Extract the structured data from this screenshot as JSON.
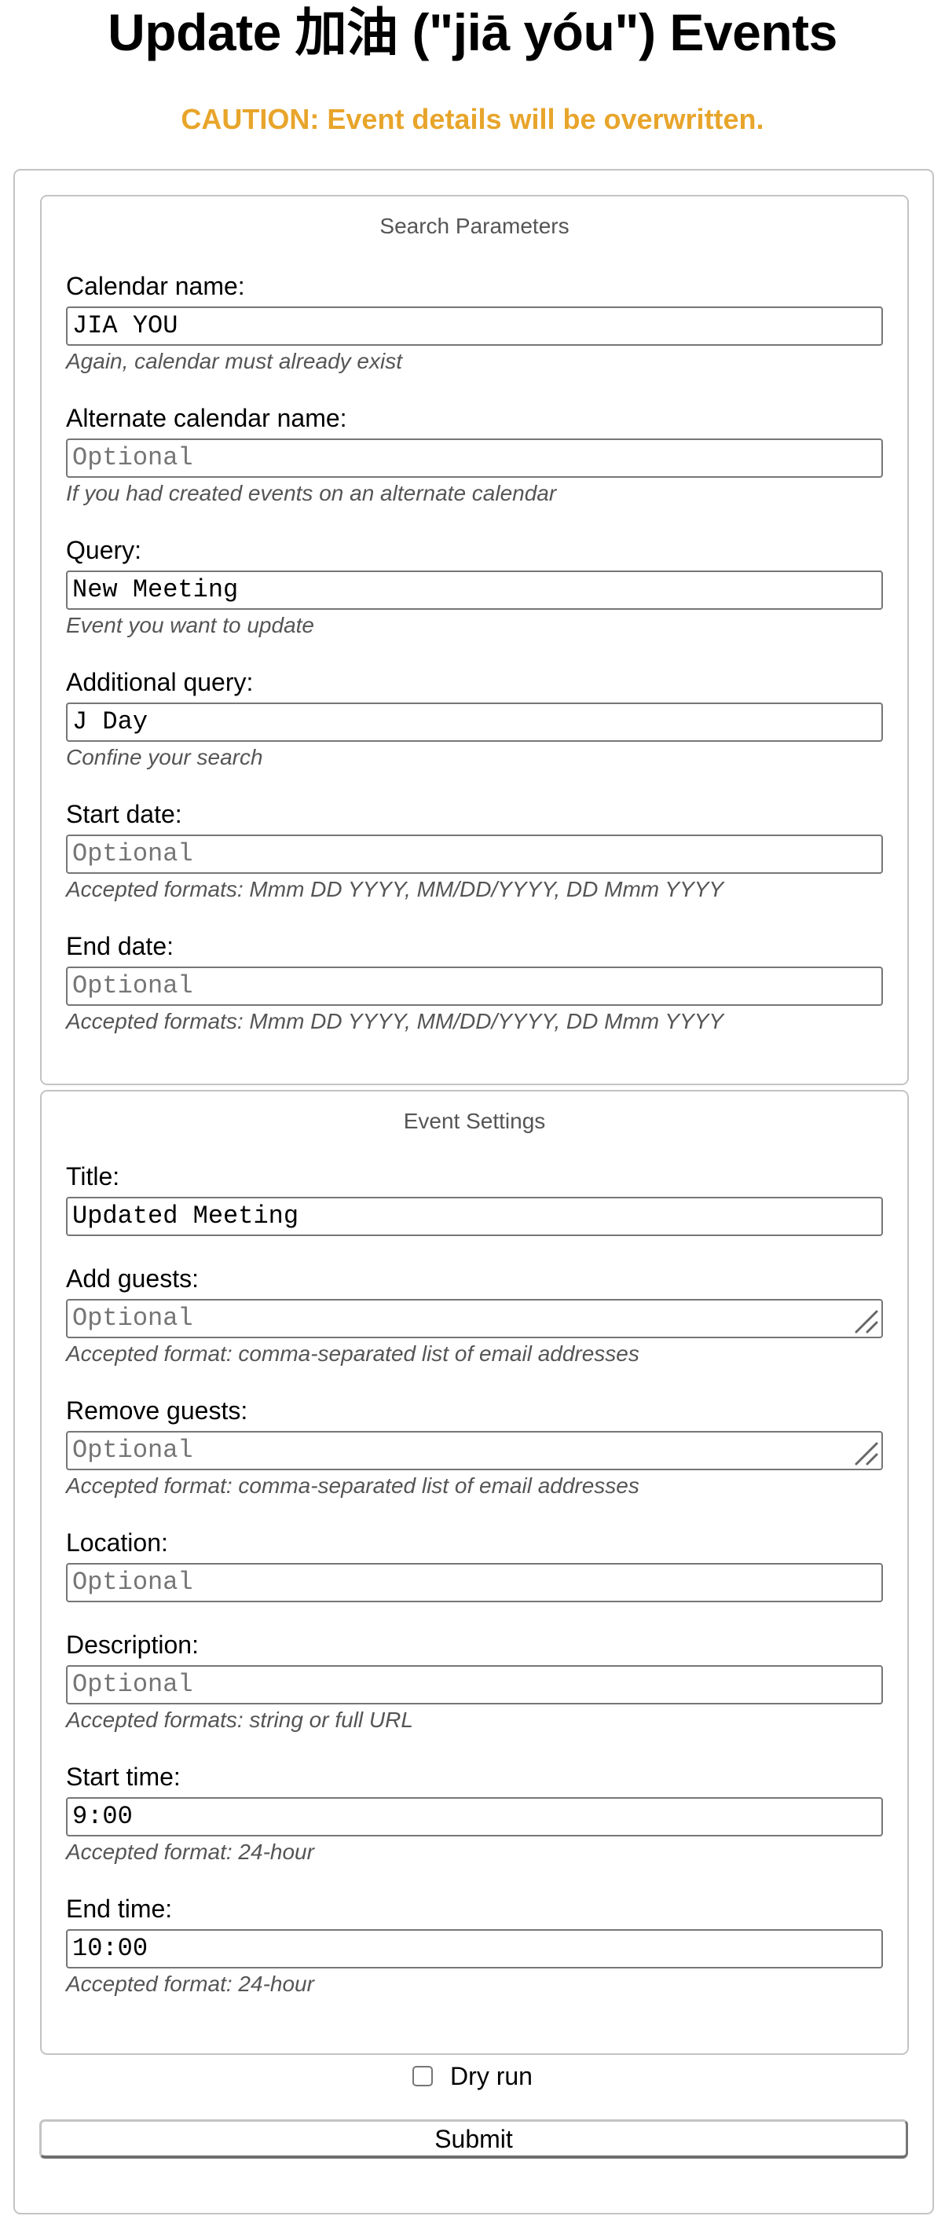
{
  "header": {
    "title": "Update 加油 (\"jiā yóu\") Events",
    "caution": "CAUTION: Event details will be overwritten.",
    "caution_color": "#E8A52B"
  },
  "search": {
    "legend": "Search Parameters",
    "fields": [
      {
        "label": "Calendar name:",
        "value": "JIA YOU",
        "placeholder": "",
        "hint": "Again, calendar must already exist"
      },
      {
        "label": "Alternate calendar name:",
        "value": "",
        "placeholder": "Optional",
        "hint": "If you had created events on an alternate calendar"
      },
      {
        "label": "Query:",
        "value": "New Meeting",
        "placeholder": "",
        "hint": "Event you want to update"
      },
      {
        "label": "Additional query:",
        "value": "J Day",
        "placeholder": "",
        "hint": "Confine your search"
      },
      {
        "label": "Start date:",
        "value": "",
        "placeholder": "Optional",
        "hint": "Accepted formats: Mmm DD YYYY, MM/DD/YYYY, DD Mmm YYYY"
      },
      {
        "label": "End date:",
        "value": "",
        "placeholder": "Optional",
        "hint": "Accepted formats: Mmm DD YYYY, MM/DD/YYYY, DD Mmm YYYY"
      }
    ]
  },
  "event": {
    "legend": "Event Settings",
    "fields": [
      {
        "label": "Title:",
        "value": "Updated Meeting",
        "placeholder": "",
        "hint": ""
      },
      {
        "label": "Add guests:",
        "value": "",
        "placeholder": "Optional",
        "hint": "Accepted format: comma-separated list of email addresses",
        "multiline": true
      },
      {
        "label": "Remove guests:",
        "value": "",
        "placeholder": "Optional",
        "hint": "Accepted format: comma-separated list of email addresses",
        "multiline": true
      },
      {
        "label": "Location:",
        "value": "",
        "placeholder": "Optional",
        "hint": ""
      },
      {
        "label": "Description:",
        "value": "",
        "placeholder": "Optional",
        "hint": "Accepted formats: string or full URL"
      },
      {
        "label": "Start time:",
        "value": "9:00",
        "placeholder": "",
        "hint": "Accepted format: 24-hour"
      },
      {
        "label": "End time:",
        "value": "10:00",
        "placeholder": "",
        "hint": "Accepted format: 24-hour"
      }
    ]
  },
  "options": {
    "dry_run_label": "Dry run",
    "dry_run_checked": false
  },
  "actions": {
    "submit_label": "Submit"
  }
}
